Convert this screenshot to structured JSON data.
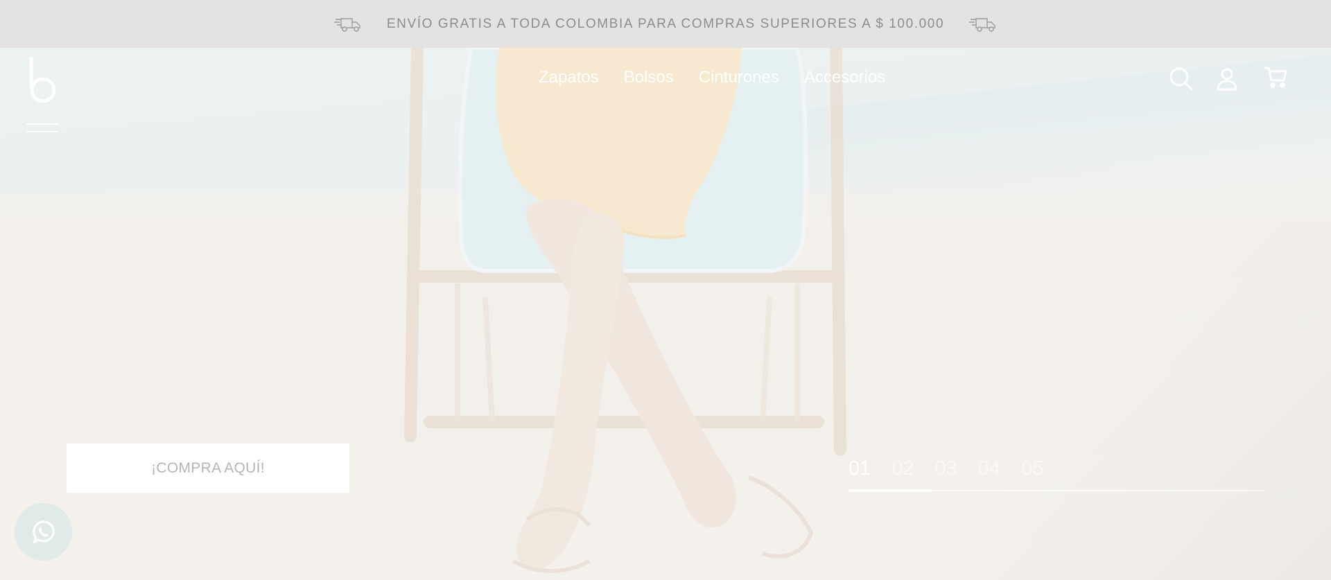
{
  "announcement": {
    "text": "ENVÍO GRATIS A TODA COLOMBIA PARA COMPRAS SUPERIORES A $ 100.000",
    "left_icon": "truck-icon",
    "right_icon": "truck-icon"
  },
  "header": {
    "logo_icon": "brand-b-logo",
    "menu_icon": "hamburger-menu-icon",
    "nav": [
      {
        "label": "Zapatos"
      },
      {
        "label": "Bolsos"
      },
      {
        "label": "Cinturones"
      },
      {
        "label": "Accesorios"
      }
    ],
    "actions": [
      {
        "icon": "search-icon"
      },
      {
        "icon": "user-icon"
      },
      {
        "icon": "cart-icon"
      }
    ]
  },
  "hero": {
    "cta_label": "¡COMPRA AQUÍ!",
    "slides": [
      "01",
      "02",
      "03",
      "04",
      "05"
    ],
    "active_slide_index": 0,
    "progress_fraction": 0.2
  },
  "whatsapp": {
    "icon": "whatsapp-icon"
  },
  "colors": {
    "topbar_bg": "#e4e3e2",
    "topbar_text": "#8c8c8c",
    "nav_text": "#ffffff",
    "cta_bg": "#ffffff",
    "cta_text": "#b5b5b5",
    "whatsapp_bg": "#dfeae9"
  }
}
